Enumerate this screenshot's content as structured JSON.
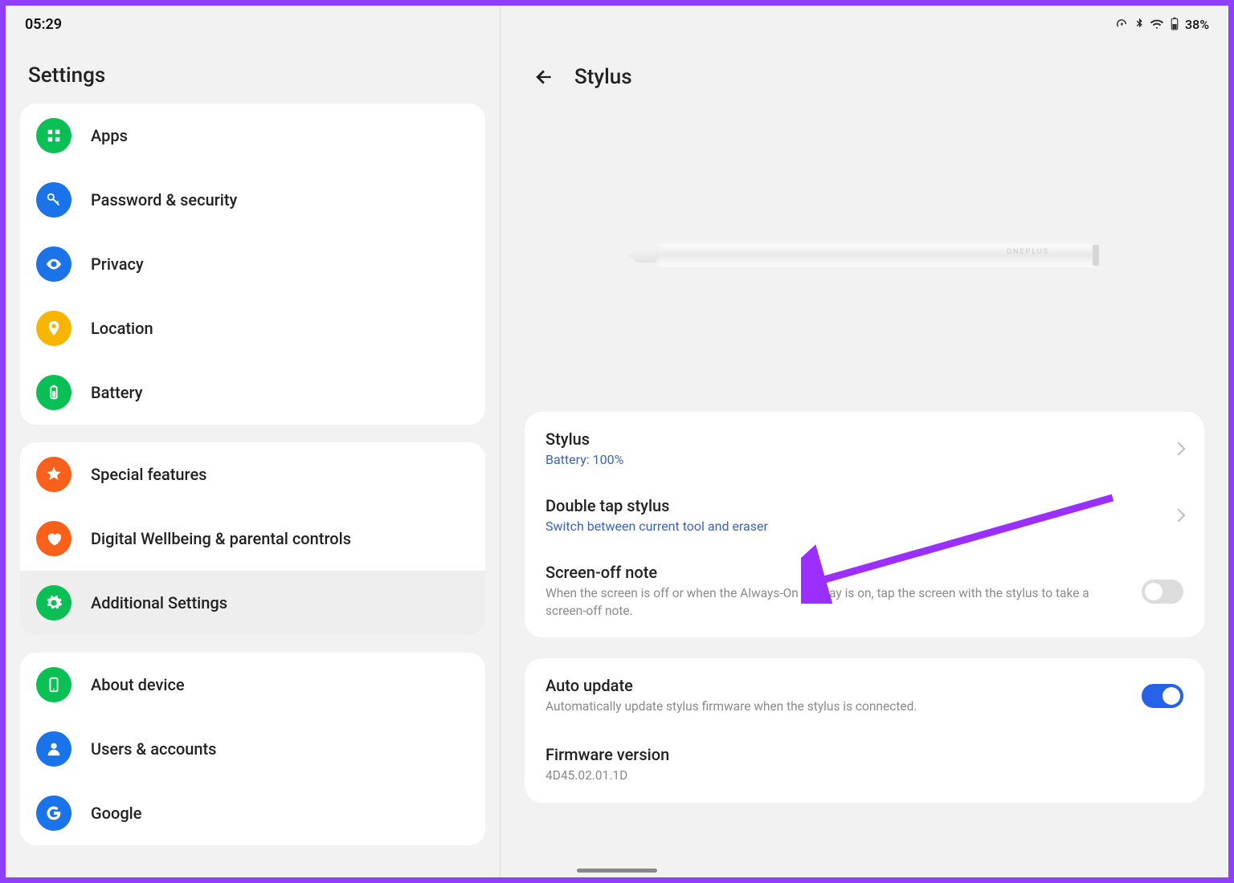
{
  "status": {
    "time": "05:29",
    "battery_text": "38%"
  },
  "left_title": "Settings",
  "sidebar": {
    "group1": [
      {
        "id": "apps",
        "label": "Apps",
        "color": "c-green",
        "icon": "grid"
      },
      {
        "id": "password",
        "label": "Password & security",
        "color": "c-blue",
        "icon": "key"
      },
      {
        "id": "privacy",
        "label": "Privacy",
        "color": "c-blue",
        "icon": "eye"
      },
      {
        "id": "location",
        "label": "Location",
        "color": "c-yellow",
        "icon": "pin"
      },
      {
        "id": "battery",
        "label": "Battery",
        "color": "c-green",
        "icon": "battery"
      }
    ],
    "group2": [
      {
        "id": "special",
        "label": "Special features",
        "color": "c-orange",
        "icon": "star"
      },
      {
        "id": "wellbeing",
        "label": "Digital Wellbeing & parental controls",
        "color": "c-orange",
        "icon": "heart"
      },
      {
        "id": "additional",
        "label": "Additional Settings",
        "color": "c-green",
        "icon": "gear",
        "selected": true
      }
    ],
    "group3": [
      {
        "id": "about",
        "label": "About device",
        "color": "c-green",
        "icon": "phone"
      },
      {
        "id": "users",
        "label": "Users & accounts",
        "color": "c-blue",
        "icon": "user"
      },
      {
        "id": "google",
        "label": "Google",
        "color": "c-blue",
        "icon": "google"
      }
    ]
  },
  "right": {
    "title": "Stylus",
    "pen_brand": "ONEPLUS",
    "items": [
      {
        "id": "stylus",
        "title": "Stylus",
        "sub": "Battery: 100%",
        "accessory": "chevron",
        "subStyle": "blue"
      },
      {
        "id": "doubletap",
        "title": "Double tap stylus",
        "sub": "Switch between current tool and eraser",
        "accessory": "chevron",
        "subStyle": "blue"
      },
      {
        "id": "screenoff",
        "title": "Screen-off note",
        "sub": "When the screen is off or when the Always-On Display is on, tap the screen with the stylus to take a screen-off note.",
        "accessory": "toggle-off",
        "subStyle": "grey"
      }
    ],
    "items2": [
      {
        "id": "autoupdate",
        "title": "Auto update",
        "sub": "Automatically update stylus firmware when the stylus is connected.",
        "accessory": "toggle-on",
        "subStyle": "grey"
      },
      {
        "id": "firmware",
        "title": "Firmware version",
        "sub": "4D45.02.01.1D",
        "accessory": "none",
        "subStyle": "grey"
      }
    ]
  }
}
